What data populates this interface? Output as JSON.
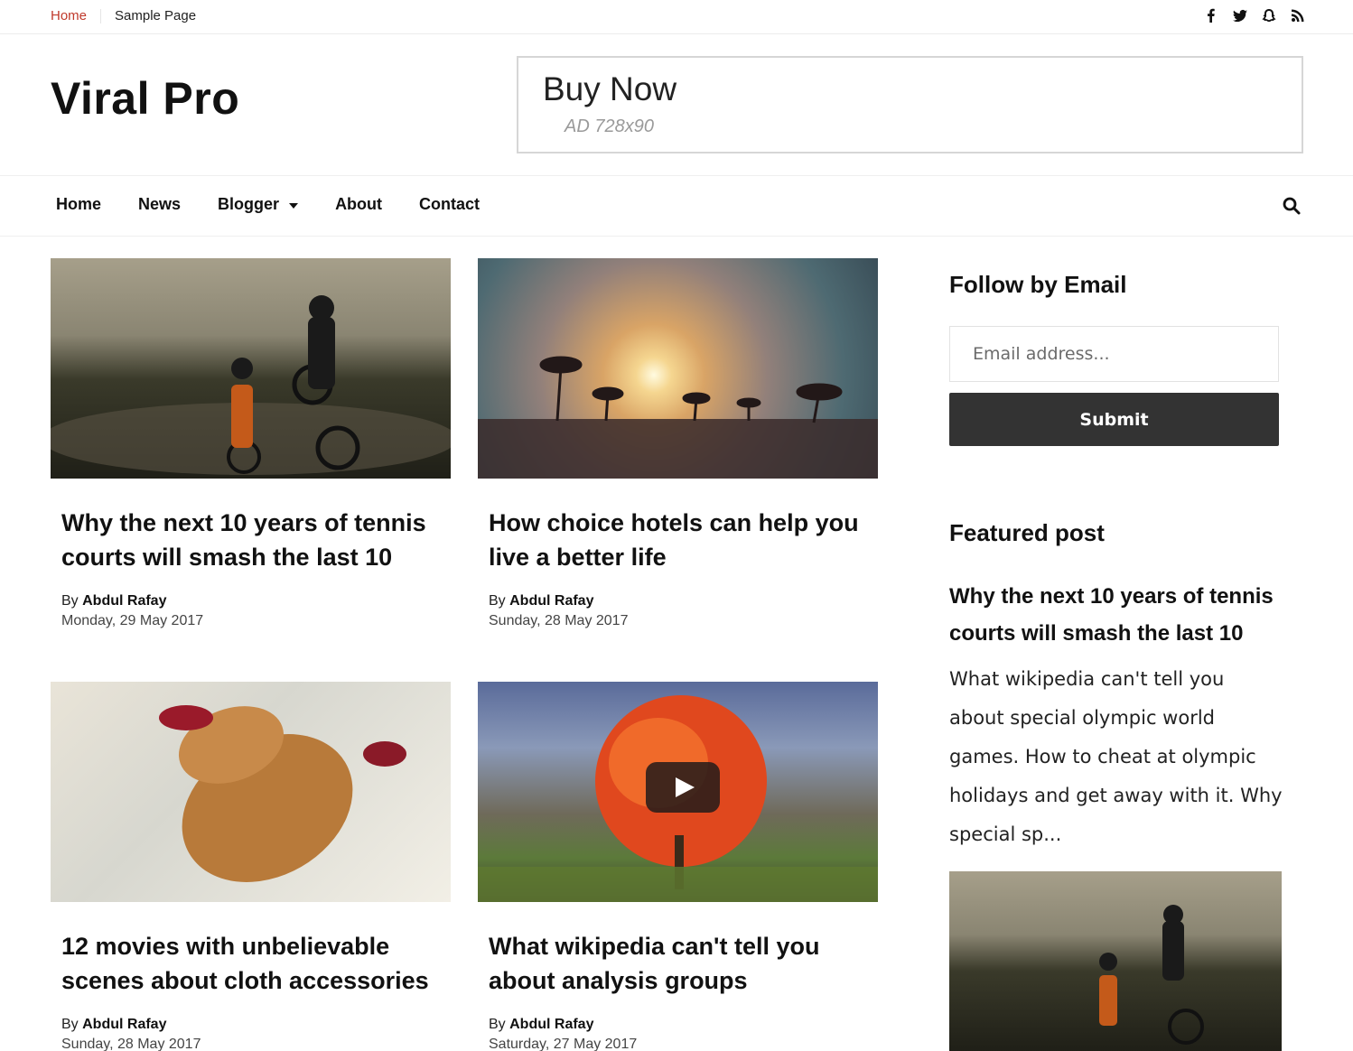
{
  "topbar": {
    "links": [
      {
        "label": "Home",
        "active": true
      },
      {
        "label": "Sample Page",
        "active": false
      }
    ],
    "social": [
      "facebook-icon",
      "twitter-icon",
      "snapchat-icon",
      "rss-icon"
    ]
  },
  "header": {
    "logo": "Viral Pro",
    "ad": {
      "title": "Buy Now",
      "size": "AD 728x90"
    }
  },
  "nav": {
    "items": [
      "Home",
      "News",
      "Blogger",
      "About",
      "Contact"
    ],
    "dropdown_item": "Blogger"
  },
  "colors": {
    "accent": "#c0392b",
    "button": "#333333"
  },
  "posts": [
    {
      "title": "Why the next 10 years of tennis courts will smash the last 10",
      "by_label": "By",
      "author": "Abdul Rafay",
      "date": "Monday, 29 May 2017",
      "image": "motocross"
    },
    {
      "title": "How choice hotels can help you live a better life",
      "by_label": "By",
      "author": "Abdul Rafay",
      "date": "Sunday, 28 May 2017",
      "image": "palm-sunset"
    },
    {
      "title": "12 movies with unbelievable scenes about cloth accessories",
      "by_label": "By",
      "author": "Abdul Rafay",
      "date": "Sunday, 28 May 2017",
      "image": "shoes"
    },
    {
      "title": "What wikipedia can't tell you about analysis groups",
      "by_label": "By",
      "author": "Abdul Rafay",
      "date": "Saturday, 27 May 2017",
      "image": "autumn-tree-video"
    }
  ],
  "sidebar": {
    "follow": {
      "title": "Follow by Email",
      "placeholder": "Email address...",
      "submit": "Submit"
    },
    "featured": {
      "title": "Featured post",
      "post_title": "Why the next 10 years of tennis courts will smash the last 10",
      "excerpt": "What wikipedia can't tell you about special olympic world games. How to cheat at olympic holidays and get away with it. Why special sp..."
    }
  }
}
